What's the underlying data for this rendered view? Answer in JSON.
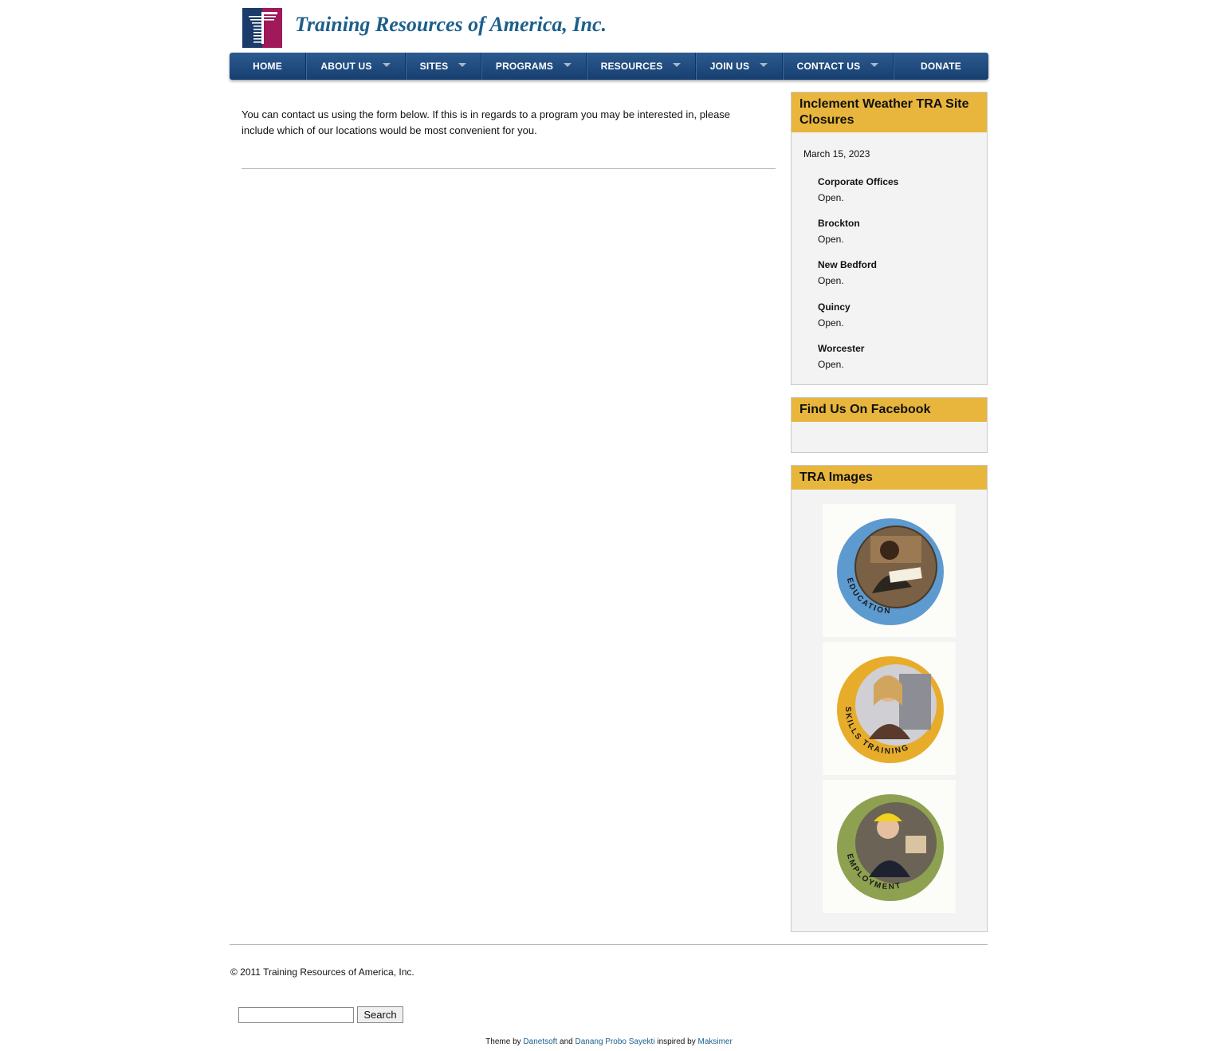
{
  "header": {
    "site_title": "Training Resources of America, Inc.",
    "logo_icon": "tra-logo-icon",
    "logo_colors": {
      "navy": "#1b3c6a",
      "magenta": "#a0195a"
    }
  },
  "nav": {
    "items": [
      {
        "label": "HOME",
        "has_caret": false
      },
      {
        "label": "ABOUT US",
        "has_caret": true
      },
      {
        "label": "SITES",
        "has_caret": true
      },
      {
        "label": "PROGRAMS",
        "has_caret": true
      },
      {
        "label": "RESOURCES",
        "has_caret": true
      },
      {
        "label": "JOIN US",
        "has_caret": true
      },
      {
        "label": "CONTACT US",
        "has_caret": true
      },
      {
        "label": "DONATE",
        "has_caret": false
      }
    ]
  },
  "main": {
    "intro": "You can contact us using the form below. If this is in regards to a program you may be interested in, please include which of our locations would be most convenient for you."
  },
  "sidebar": {
    "weather": {
      "title": "Inclement Weather TRA Site Closures",
      "date": "March 15, 2023",
      "locations": [
        {
          "name": "Corporate Offices",
          "status": "Open."
        },
        {
          "name": "Brockton",
          "status": "Open."
        },
        {
          "name": "New Bedford",
          "status": "Open."
        },
        {
          "name": "Quincy",
          "status": "Open."
        },
        {
          "name": "Worcester",
          "status": "Open."
        }
      ]
    },
    "facebook": {
      "title": "Find Us On Facebook"
    },
    "images": {
      "title": "TRA Images",
      "items": [
        {
          "label": "EDUCATION",
          "ring_color": "#5c9ad0"
        },
        {
          "label": "SKILLS TRAINING",
          "ring_color": "#e7ac2a"
        },
        {
          "label": "EMPLOYMENT",
          "ring_color": "#8ea151"
        }
      ]
    }
  },
  "footer": {
    "copyright": "© 2011 Training Resources of America, Inc.",
    "search_button": "Search",
    "credits": {
      "prefix": "Theme by",
      "link1": "Danetsoft",
      "and": "and",
      "link2": "Danang Probo Sayekti",
      "inspired": "inspired by",
      "link3": "Maksimer"
    }
  },
  "colors": {
    "nav": "#1f4a7e",
    "accent_heading": "#e8b63c",
    "title_blue": "#1c5f8b"
  }
}
